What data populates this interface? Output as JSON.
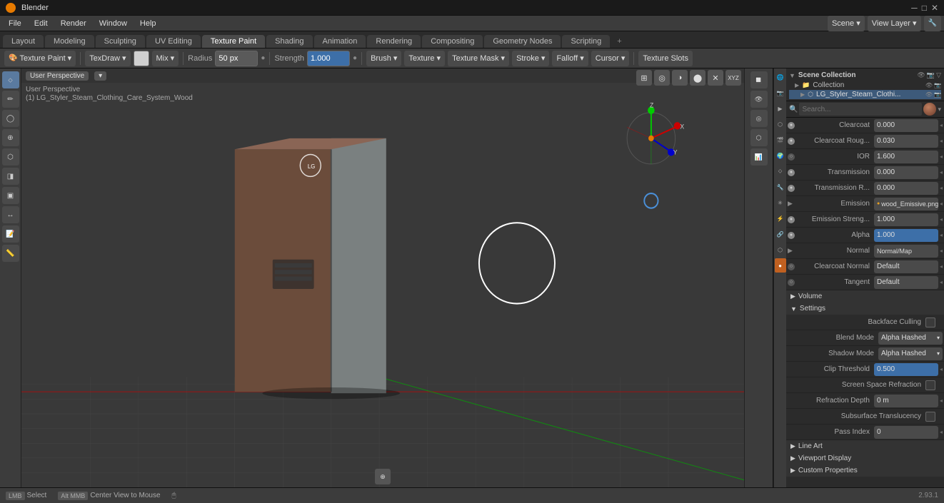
{
  "app": {
    "title": "Blender",
    "version": "2.93.1"
  },
  "titlebar": {
    "title": "Blender",
    "minimize": "─",
    "maximize": "□",
    "close": "✕"
  },
  "menubar": {
    "items": [
      "File",
      "Edit",
      "Render",
      "Window",
      "Help"
    ]
  },
  "workspacetabs": {
    "tabs": [
      "Layout",
      "Modeling",
      "Sculpting",
      "UV Editing",
      "Texture Paint",
      "Shading",
      "Animation",
      "Rendering",
      "Compositing",
      "Geometry Nodes",
      "Scripting"
    ],
    "active": "Texture Paint",
    "plus": "+"
  },
  "toolbar": {
    "mode_label": "Texture Paint",
    "brush_label": "TexDraw",
    "color_swatch": "",
    "blend_mode": "Mix",
    "radius_label": "Radius",
    "radius_value": "50 px",
    "strength_label": "Strength",
    "strength_value": "1.000",
    "brush_btn": "Brush ▾",
    "texture_btn": "Texture ▾",
    "texture_mask_btn": "Texture Mask ▾",
    "stroke_btn": "Stroke ▾",
    "falloff_btn": "Falloff ▾",
    "cursor_btn": "Cursor ▾",
    "texture_slots_btn": "Texture Slots"
  },
  "viewport": {
    "perspective": "User Perspective",
    "object_name": "(1) LG_Styler_Steam_Clothing_Care_System_Wood",
    "overlay_buttons": [
      "🔲",
      "◎",
      "👁",
      "✕"
    ]
  },
  "scene_collection": {
    "title": "Scene Collection",
    "items": [
      {
        "name": "Collection",
        "icon": "▶",
        "visible": true
      },
      {
        "name": "LG_Styler_Steam_Clothi...",
        "icon": "▶",
        "visible": true,
        "selected": true
      }
    ]
  },
  "properties": {
    "search_placeholder": "Search...",
    "sections": [
      {
        "name": "material_props",
        "rows": [
          {
            "label": "Clearcoat",
            "value": "0.000",
            "has_dot": true
          },
          {
            "label": "Clearcoat Roug...",
            "value": "0.030",
            "has_dot": true
          },
          {
            "label": "IOR",
            "value": "1.600",
            "has_dot": false
          },
          {
            "label": "Transmission",
            "value": "0.000",
            "has_dot": true
          },
          {
            "label": "Transmission R...",
            "value": "0.000",
            "has_dot": true
          },
          {
            "label": "Emission",
            "value": "wood_Emissive.png",
            "has_dot": true,
            "is_texture": true
          },
          {
            "label": "Emission Streng...",
            "value": "1.000",
            "has_dot": true
          },
          {
            "label": "Alpha",
            "value": "1.000",
            "has_dot": true,
            "is_blue": true
          },
          {
            "label": "Normal",
            "value": "Normal/Map",
            "has_dot": false,
            "is_arrow": true
          },
          {
            "label": "Clearcoat Normal",
            "value": "Default",
            "has_dot": false
          },
          {
            "label": "Tangent",
            "value": "Default",
            "has_dot": false
          }
        ]
      },
      {
        "name": "Volume",
        "collapsed": true
      },
      {
        "name": "Settings",
        "collapsed": false,
        "rows": [
          {
            "label": "Backface Culling",
            "value": "",
            "is_checkbox": true,
            "checked": false
          },
          {
            "label": "Blend Mode",
            "value": "Alpha Hashed",
            "is_dropdown": true
          },
          {
            "label": "Shadow Mode",
            "value": "Alpha Hashed",
            "is_dropdown": true
          },
          {
            "label": "Clip Threshold",
            "value": "0.500",
            "is_blue": true
          },
          {
            "label": "Screen Space Refraction",
            "value": "",
            "is_checkbox": true,
            "checked": false
          },
          {
            "label": "Refraction Depth",
            "value": "0 m"
          },
          {
            "label": "Subsurface Translucency",
            "value": "",
            "is_checkbox": true,
            "checked": false
          },
          {
            "label": "Pass Index",
            "value": "0"
          }
        ]
      },
      {
        "name": "Line Art",
        "collapsed": true
      },
      {
        "name": "Viewport Display",
        "collapsed": true
      },
      {
        "name": "Custom Properties",
        "collapsed": true
      }
    ]
  },
  "statusbar": {
    "select": "Select",
    "center_view": "Center View to Mouse",
    "version": "2.93.1"
  },
  "prop_icons": [
    "🌐",
    "📷",
    "▶",
    "⬡",
    "🔴",
    "🔧",
    "🔩",
    "📋",
    "🎨",
    "🔬"
  ],
  "left_tools": [
    "⬦",
    "✏",
    "😊",
    "⊙",
    "⬡",
    "↩",
    "🔧",
    "📌",
    "📷",
    "❓"
  ]
}
